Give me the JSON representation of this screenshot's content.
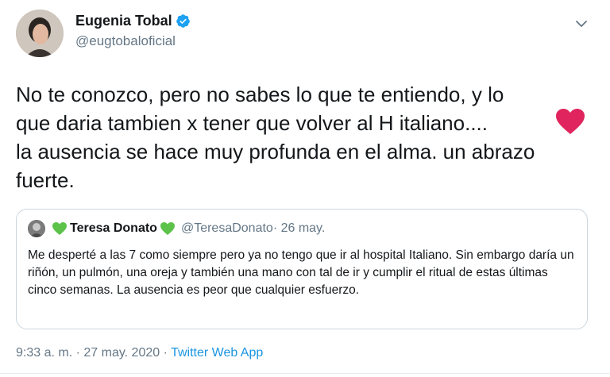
{
  "author": {
    "display_name": "Eugenia Tobal",
    "handle": "@eugtobaloficial",
    "verified_icon": "verified-badge-icon"
  },
  "tweet": {
    "text": "No te conozco, pero no sabes lo que te entiendo, y lo\nque daria tambien x tener que volver al H italiano....\nla ausencia se hace muy profunda en el alma. un abrazo\nfuerte.",
    "emoji_icon": "red-heart-icon"
  },
  "quoted_tweet": {
    "name": "Teresa Donato",
    "handle": "@TeresaDonato",
    "date": " · 26 may.",
    "name_emoji_icon": "green-heart-icon",
    "text": "Me desperté a las 7 como siempre pero ya no tengo que ir al hospital Italiano. Sin embargo daría un riñón, un pulmón, una oreja y también una mano con tal de ir y cumplir el ritual de estas últimas cinco semanas. La ausencia es peor que cualquier esfuerzo."
  },
  "footer": {
    "time_date": "9:33 a. m. · 27 may. 2020 · ",
    "app": "Twitter Web App"
  },
  "colors": {
    "link": "#1b95e0",
    "secondary_text": "#657786",
    "heart_red": "#e0245e",
    "heart_green": "#5cc24a"
  }
}
